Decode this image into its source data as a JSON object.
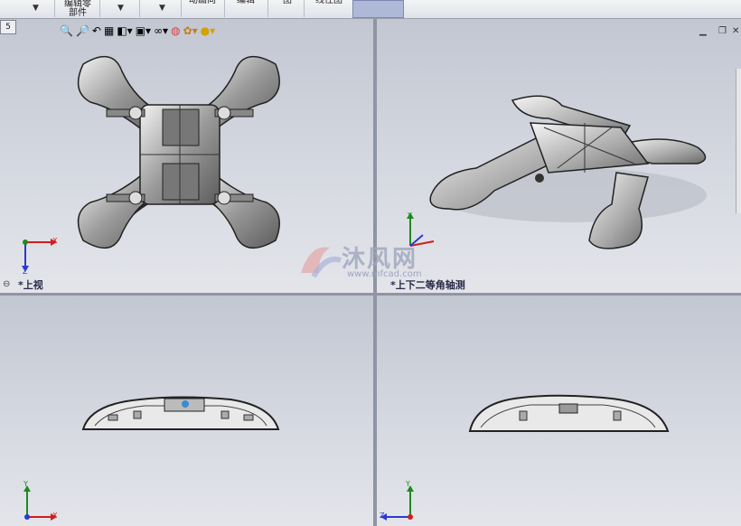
{
  "toolbar": {
    "items": [
      {
        "label": "编辑零\n部件"
      },
      {
        "label": "动画向"
      },
      {
        "label": "编辑"
      },
      {
        "label": "图"
      },
      {
        "label": "线性图"
      }
    ],
    "tab_number": "5"
  },
  "views": {
    "top_label": "*上视",
    "iso_label": "*上下二等角轴测"
  },
  "axes": {
    "x": "X",
    "y": "Y",
    "z": "Z"
  },
  "watermark": {
    "text": "沐风网",
    "url": "www.mfcad.com"
  },
  "colors": {
    "viewport_bg": "#c9cdd6",
    "axis_x": "#d31d1d",
    "axis_y": "#1e8a1e",
    "axis_z": "#2a3ad0"
  }
}
